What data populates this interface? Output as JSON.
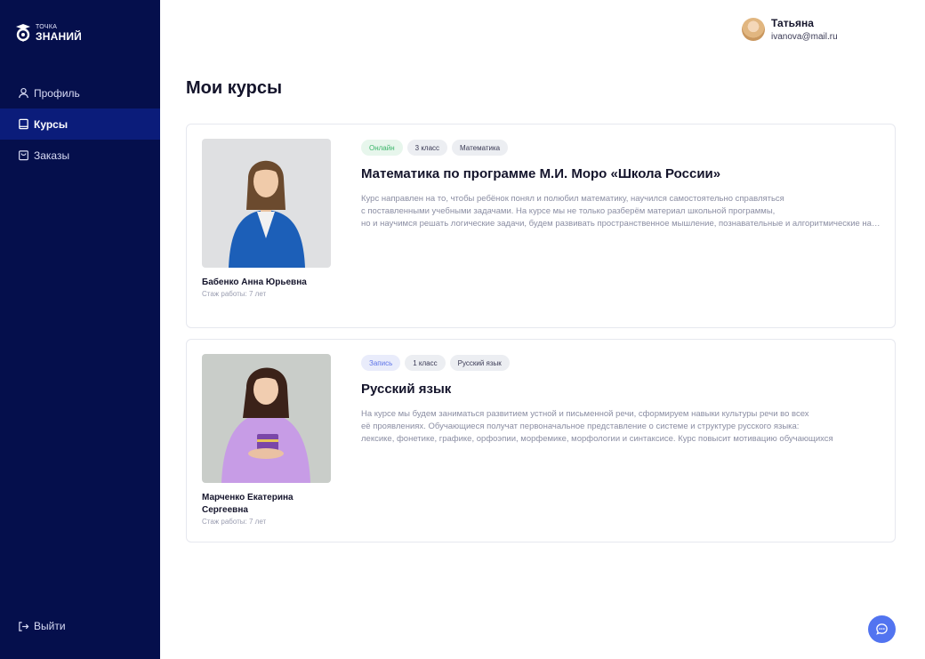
{
  "brand": {
    "line1": "ТОЧКА",
    "line2": "ЗНАНИЙ"
  },
  "sidebar": {
    "items": [
      {
        "label": "Профиль",
        "icon": "user-icon",
        "active": false
      },
      {
        "label": "Курсы",
        "icon": "book-icon",
        "active": true
      },
      {
        "label": "Заказы",
        "icon": "bag-icon",
        "active": false
      }
    ],
    "logout": "Выйти"
  },
  "user": {
    "name": "Татьяна",
    "email": "ivanova@mail.ru"
  },
  "page": {
    "title": "Мои курсы"
  },
  "courses": [
    {
      "tags": [
        "Онлайн",
        "3 класс",
        "Математика"
      ],
      "title": "Математика по программе М.И. Моро «Школа России»",
      "description": [
        "Курс направлен на то, чтобы ребёнок понял и полюбил математику, научился самостоятельно справляться",
        "с поставленными учебными задачами. На курсе мы не только разберём материал школьной программы,",
        "но и научимся решать логические задачи, будем развивать пространственное мышление, познавательные и алгоритмические навыки"
      ],
      "teacher": {
        "name": "Бабенко Анна Юрьевна",
        "experience": "Стаж работы: 7 лет"
      }
    },
    {
      "tags": [
        "Запись",
        "1 класс",
        "Русский язык"
      ],
      "title": "Русский язык",
      "description": [
        "На курсе мы будем заниматься развитием устной и письменной речи, сформируем навыки культуры речи во всех",
        "её проявлениях. Обучающиеся получат первоначальное представление о системе и структуре русского языка:",
        "лексике, фонетике, графике, орфоэпии, морфемике, морфологии и синтаксисе. Курс повысит мотивацию обучающихся"
      ],
      "teacher": {
        "name": "Марченко Екатерина Сергеевна",
        "experience": "Стаж работы: 7 лет"
      }
    }
  ],
  "colors": {
    "sidebar": "#050f4c",
    "sidebar_active": "#0b1c7a",
    "accent": "#5274f0",
    "tag_online": "#3bb56a",
    "tag_enroll": "#5d73e8"
  },
  "chat": {
    "icon": "chat-icon"
  }
}
